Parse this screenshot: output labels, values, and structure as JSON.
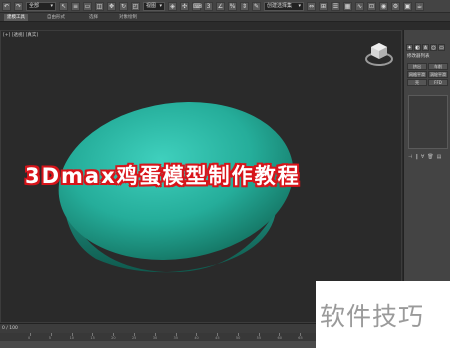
{
  "toolbar": {
    "selection_filter": "全部",
    "view_dropdown": "视图",
    "named_selection": "创建选择集"
  },
  "ribbon_tabs": [
    "建模工具",
    "自由形式",
    "选择",
    "对象绘制"
  ],
  "viewport": {
    "label": "[+] [透视] [真实]",
    "object_color": "#2bb3a0"
  },
  "overlay": {
    "tutorial_title": "3Dmax鸡蛋模型制作教程",
    "title_outline_color": "#d8141a"
  },
  "command_panel": {
    "title": "修改器列表",
    "buttons": [
      "挤出",
      "车削",
      "网格平滑",
      "涡轮平滑",
      "壳",
      "FFD"
    ]
  },
  "timeline": {
    "frame_label": "0 / 100",
    "ticks": [
      "0",
      "5",
      "10",
      "15",
      "20",
      "25",
      "30",
      "35",
      "40",
      "45",
      "50",
      "55",
      "60",
      "65",
      "70",
      "75",
      "80",
      "85",
      "90",
      "95"
    ]
  },
  "watermark": {
    "text": "软件技巧"
  }
}
